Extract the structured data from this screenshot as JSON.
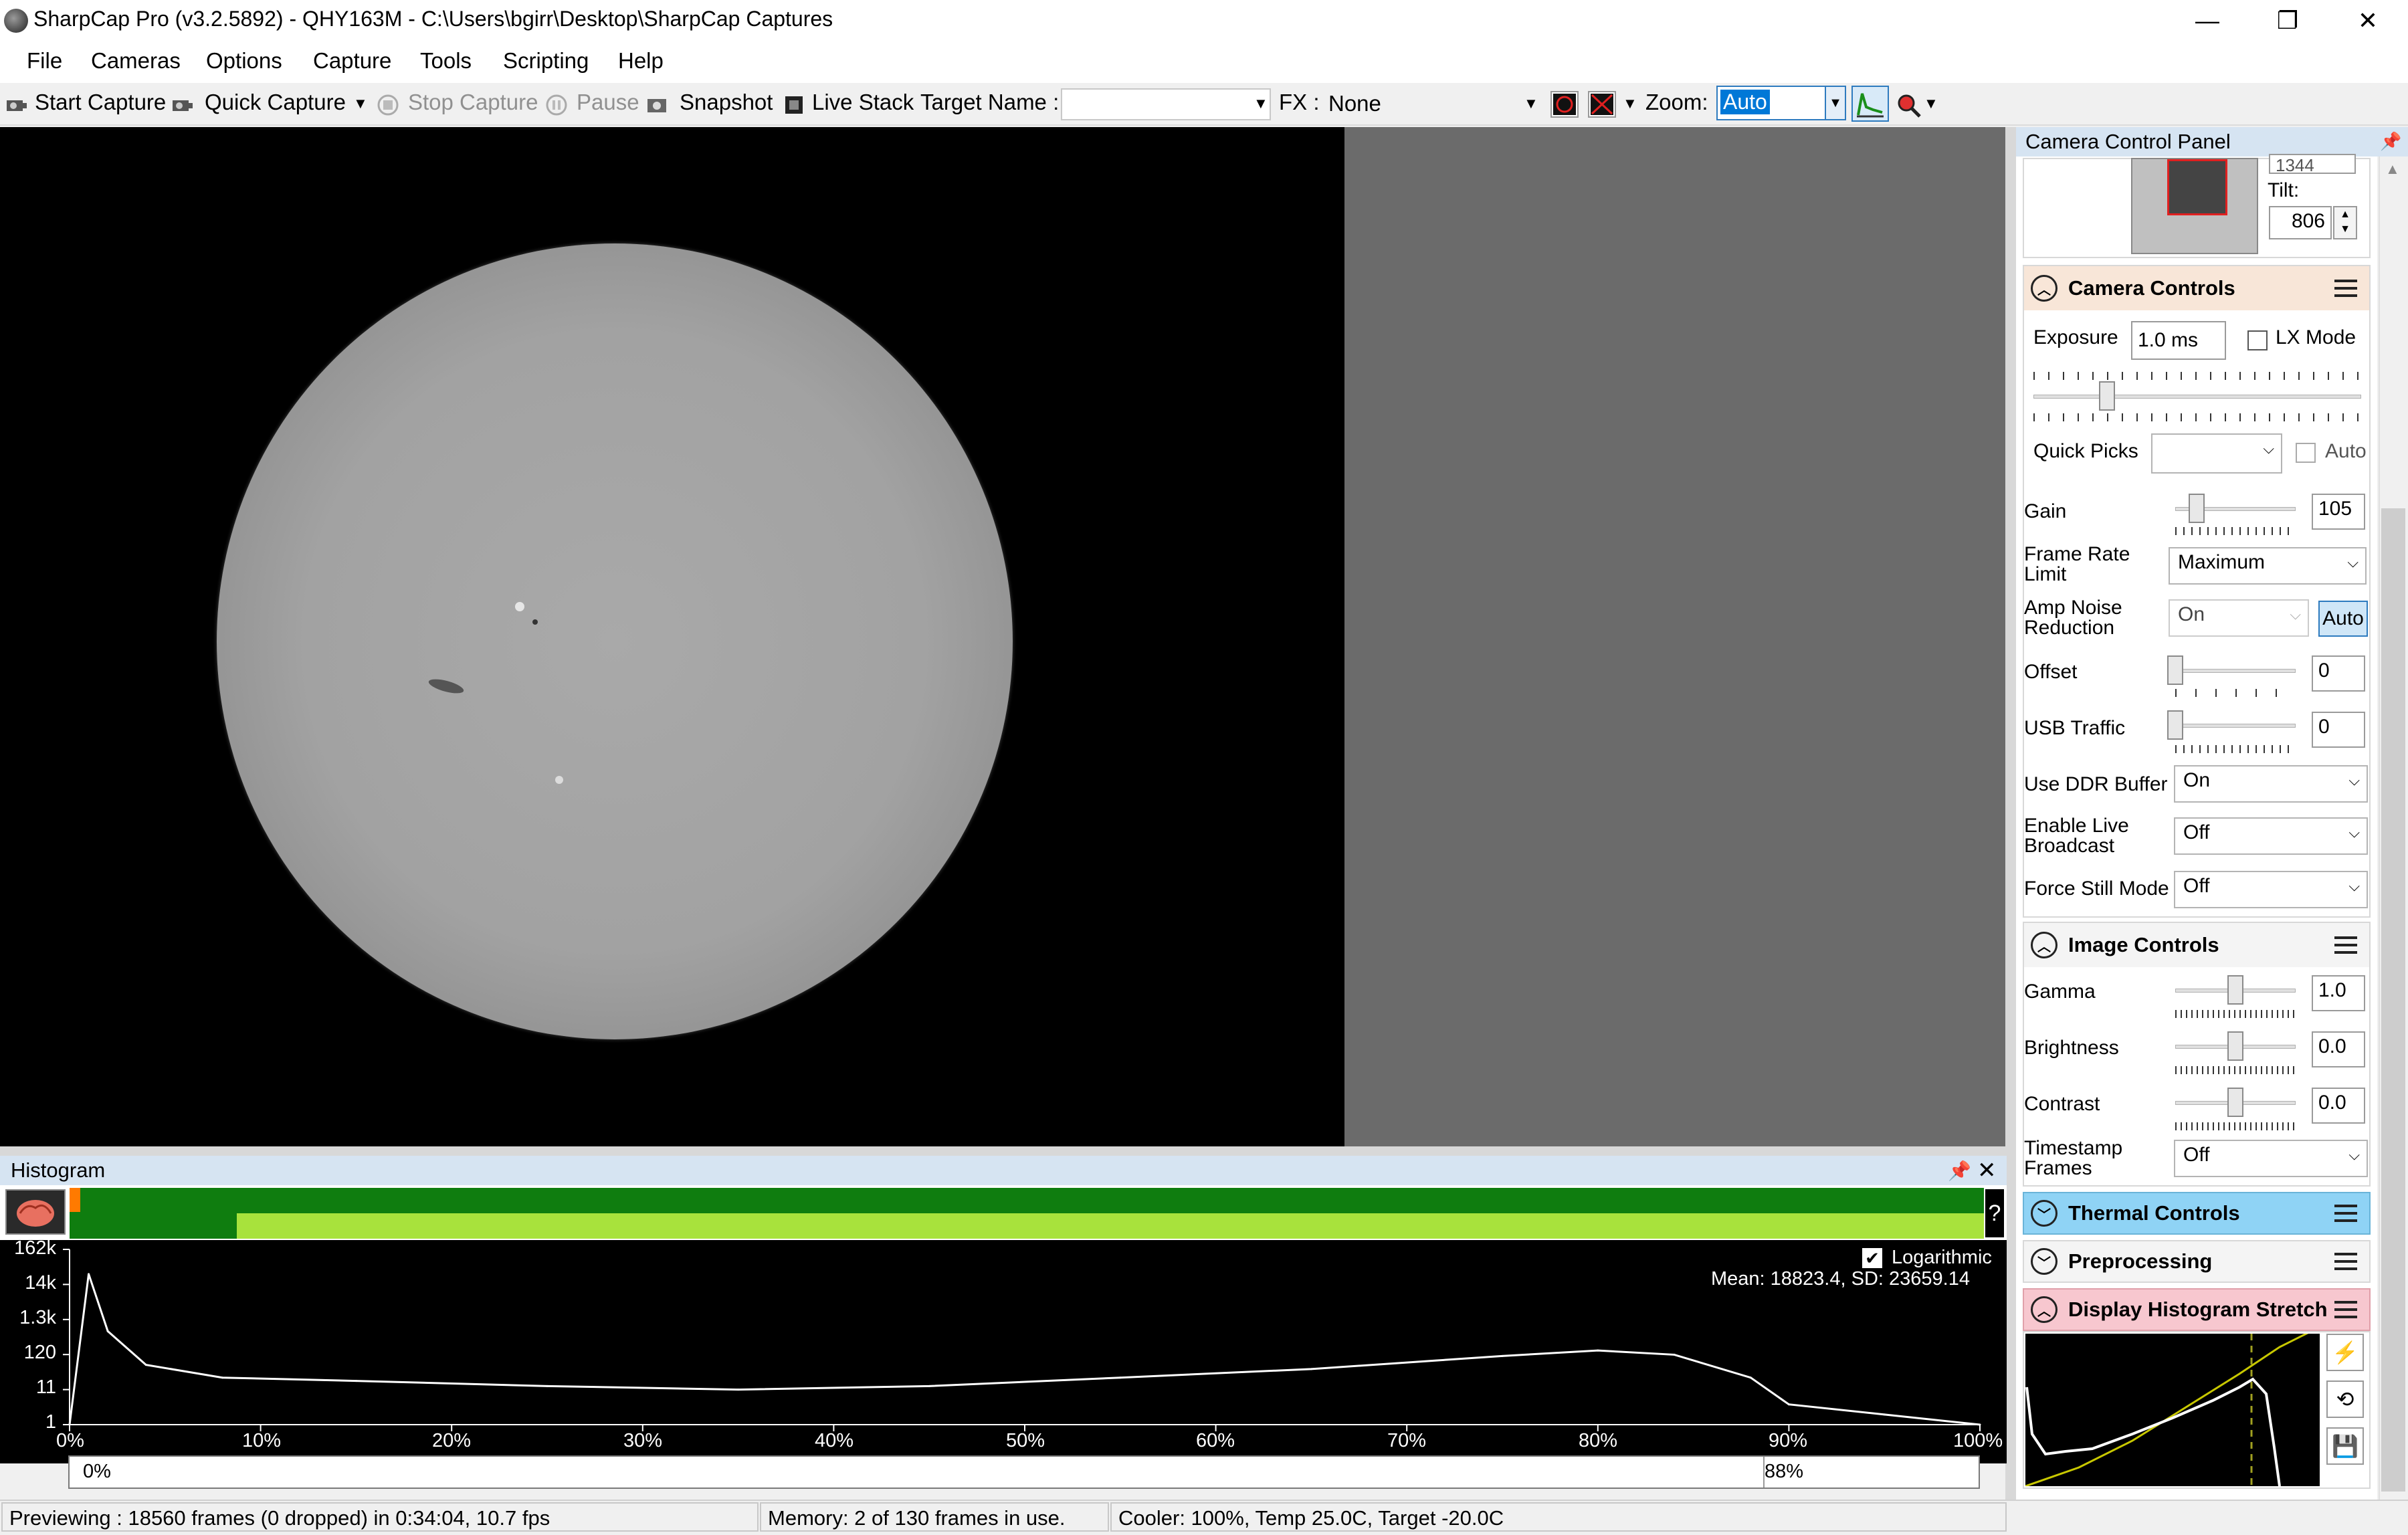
{
  "window": {
    "title": "SharpCap Pro (v3.2.5892) - QHY163M - C:\\Users\\bgirr\\Desktop\\SharpCap Captures",
    "minimize": "—",
    "maximize": "❐",
    "close": "✕"
  },
  "menu": [
    "File",
    "Cameras",
    "Options",
    "Capture",
    "Tools",
    "Scripting",
    "Help"
  ],
  "toolbar": {
    "start_capture": "Start Capture",
    "quick_capture": "Quick Capture",
    "stop_capture": "Stop Capture",
    "pause": "Pause",
    "snapshot": "Snapshot",
    "live_stack": "Live Stack",
    "target_name_label": "Target Name :",
    "target_name_value": "",
    "fx_label": "FX :",
    "fx_value": "None",
    "zoom_label": "Zoom:",
    "zoom_value": "Auto"
  },
  "histogram": {
    "title": "Histogram",
    "help": "?",
    "y_labels": [
      "162k",
      "14k",
      "1.3k",
      "120",
      "11",
      "1"
    ],
    "x_labels": [
      "0%",
      "10%",
      "20%",
      "30%",
      "40%",
      "50%",
      "60%",
      "70%",
      "80%",
      "90%",
      "100%"
    ],
    "logarithmic_label": "Logarithmic",
    "logarithmic_checked": true,
    "mean_sd": "Mean: 18823.4, SD: 23659.14",
    "range_min": "0%",
    "range_max": "88%",
    "chart_data": {
      "type": "area",
      "xlabel": "",
      "ylabel": "",
      "y_scale": "log",
      "x": [
        0,
        1,
        2,
        4,
        8,
        15,
        25,
        35,
        45,
        55,
        65,
        75,
        80,
        84,
        88,
        90,
        95,
        100
      ],
      "y": [
        1,
        30000,
        600,
        60,
        25,
        20,
        14,
        11,
        14,
        25,
        45,
        110,
        160,
        120,
        25,
        4,
        2,
        1
      ]
    }
  },
  "status": {
    "previewing": "Previewing : 18560 frames (0 dropped) in 0:34:04, 10.7 fps",
    "memory": "Memory: 2 of 130 frames in use.",
    "cooler": "Cooler: 100%, Temp 25.0C, Target -20.0C"
  },
  "camera_panel": {
    "title": "Camera Control Panel",
    "pin_icon": "pin-icon",
    "roi": {
      "pan_value": "1344",
      "tilt_label": "Tilt:",
      "tilt_value": "806"
    },
    "camera_controls": {
      "header": "Camera Controls",
      "exposure_label": "Exposure",
      "exposure_value": "1.0 ms",
      "lx_mode_label": "LX Mode",
      "lx_mode_checked": false,
      "quick_picks_label": "Quick Picks",
      "quick_picks_value": "",
      "auto_label": "Auto",
      "auto_checked": false,
      "gain_label": "Gain",
      "gain_value": "105",
      "frame_rate_label": "Frame Rate Limit",
      "frame_rate_value": "Maximum",
      "amp_noise_label": "Amp Noise Reduction",
      "amp_noise_value": "On",
      "amp_noise_auto": "Auto",
      "offset_label": "Offset",
      "offset_value": "0",
      "usb_traffic_label": "USB Traffic",
      "usb_traffic_value": "0",
      "ddr_label": "Use DDR Buffer",
      "ddr_value": "On",
      "live_broadcast_label": "Enable Live Broadcast",
      "live_broadcast_value": "Off",
      "force_still_label": "Force Still Mode",
      "force_still_value": "Off"
    },
    "image_controls": {
      "header": "Image Controls",
      "gamma_label": "Gamma",
      "gamma_value": "1.0",
      "brightness_label": "Brightness",
      "brightness_value": "0.0",
      "contrast_label": "Contrast",
      "contrast_value": "0.0",
      "timestamp_label": "Timestamp Frames",
      "timestamp_value": "Off"
    },
    "thermal_controls": {
      "header": "Thermal Controls"
    },
    "preprocessing": {
      "header": "Preprocessing"
    },
    "display_stretch": {
      "header": "Display Histogram Stretch"
    }
  },
  "colors": {
    "histogram_dark_green": "#0f7d0f",
    "histogram_light_green": "#a8e23c",
    "thermal_header": "#8fd3f5",
    "stretch_header": "#f7c7cf",
    "camera_header": "#f8e6d8",
    "accent_blue": "#2e7bbf"
  }
}
